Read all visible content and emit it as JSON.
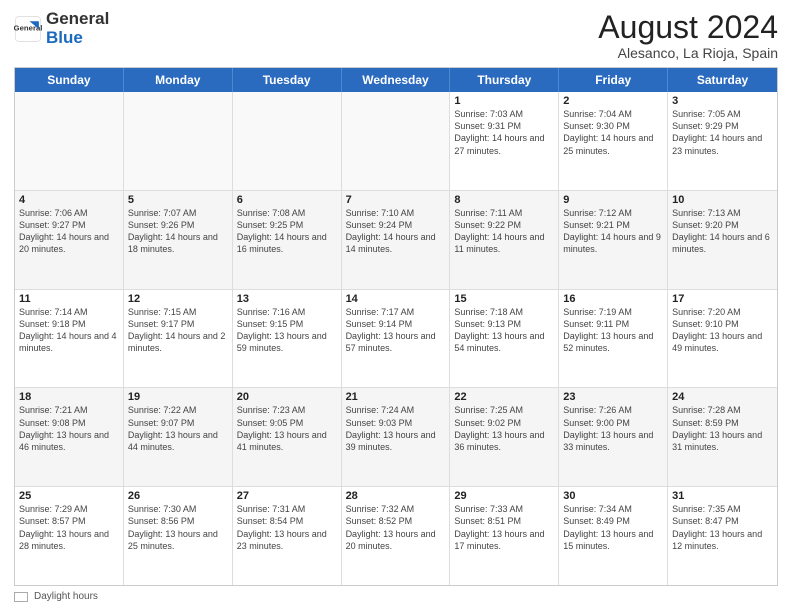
{
  "header": {
    "logo_general": "General",
    "logo_blue": "Blue",
    "main_title": "August 2024",
    "subtitle": "Alesanco, La Rioja, Spain"
  },
  "calendar": {
    "weekdays": [
      "Sunday",
      "Monday",
      "Tuesday",
      "Wednesday",
      "Thursday",
      "Friday",
      "Saturday"
    ],
    "rows": [
      {
        "alt": false,
        "cells": [
          {
            "day": "",
            "info": "",
            "empty": true
          },
          {
            "day": "",
            "info": "",
            "empty": true
          },
          {
            "day": "",
            "info": "",
            "empty": true
          },
          {
            "day": "",
            "info": "",
            "empty": true
          },
          {
            "day": "1",
            "info": "Sunrise: 7:03 AM\nSunset: 9:31 PM\nDaylight: 14 hours and 27 minutes.",
            "empty": false
          },
          {
            "day": "2",
            "info": "Sunrise: 7:04 AM\nSunset: 9:30 PM\nDaylight: 14 hours and 25 minutes.",
            "empty": false
          },
          {
            "day": "3",
            "info": "Sunrise: 7:05 AM\nSunset: 9:29 PM\nDaylight: 14 hours and 23 minutes.",
            "empty": false
          }
        ]
      },
      {
        "alt": true,
        "cells": [
          {
            "day": "4",
            "info": "Sunrise: 7:06 AM\nSunset: 9:27 PM\nDaylight: 14 hours and 20 minutes.",
            "empty": false
          },
          {
            "day": "5",
            "info": "Sunrise: 7:07 AM\nSunset: 9:26 PM\nDaylight: 14 hours and 18 minutes.",
            "empty": false
          },
          {
            "day": "6",
            "info": "Sunrise: 7:08 AM\nSunset: 9:25 PM\nDaylight: 14 hours and 16 minutes.",
            "empty": false
          },
          {
            "day": "7",
            "info": "Sunrise: 7:10 AM\nSunset: 9:24 PM\nDaylight: 14 hours and 14 minutes.",
            "empty": false
          },
          {
            "day": "8",
            "info": "Sunrise: 7:11 AM\nSunset: 9:22 PM\nDaylight: 14 hours and 11 minutes.",
            "empty": false
          },
          {
            "day": "9",
            "info": "Sunrise: 7:12 AM\nSunset: 9:21 PM\nDaylight: 14 hours and 9 minutes.",
            "empty": false
          },
          {
            "day": "10",
            "info": "Sunrise: 7:13 AM\nSunset: 9:20 PM\nDaylight: 14 hours and 6 minutes.",
            "empty": false
          }
        ]
      },
      {
        "alt": false,
        "cells": [
          {
            "day": "11",
            "info": "Sunrise: 7:14 AM\nSunset: 9:18 PM\nDaylight: 14 hours and 4 minutes.",
            "empty": false
          },
          {
            "day": "12",
            "info": "Sunrise: 7:15 AM\nSunset: 9:17 PM\nDaylight: 14 hours and 2 minutes.",
            "empty": false
          },
          {
            "day": "13",
            "info": "Sunrise: 7:16 AM\nSunset: 9:15 PM\nDaylight: 13 hours and 59 minutes.",
            "empty": false
          },
          {
            "day": "14",
            "info": "Sunrise: 7:17 AM\nSunset: 9:14 PM\nDaylight: 13 hours and 57 minutes.",
            "empty": false
          },
          {
            "day": "15",
            "info": "Sunrise: 7:18 AM\nSunset: 9:13 PM\nDaylight: 13 hours and 54 minutes.",
            "empty": false
          },
          {
            "day": "16",
            "info": "Sunrise: 7:19 AM\nSunset: 9:11 PM\nDaylight: 13 hours and 52 minutes.",
            "empty": false
          },
          {
            "day": "17",
            "info": "Sunrise: 7:20 AM\nSunset: 9:10 PM\nDaylight: 13 hours and 49 minutes.",
            "empty": false
          }
        ]
      },
      {
        "alt": true,
        "cells": [
          {
            "day": "18",
            "info": "Sunrise: 7:21 AM\nSunset: 9:08 PM\nDaylight: 13 hours and 46 minutes.",
            "empty": false
          },
          {
            "day": "19",
            "info": "Sunrise: 7:22 AM\nSunset: 9:07 PM\nDaylight: 13 hours and 44 minutes.",
            "empty": false
          },
          {
            "day": "20",
            "info": "Sunrise: 7:23 AM\nSunset: 9:05 PM\nDaylight: 13 hours and 41 minutes.",
            "empty": false
          },
          {
            "day": "21",
            "info": "Sunrise: 7:24 AM\nSunset: 9:03 PM\nDaylight: 13 hours and 39 minutes.",
            "empty": false
          },
          {
            "day": "22",
            "info": "Sunrise: 7:25 AM\nSunset: 9:02 PM\nDaylight: 13 hours and 36 minutes.",
            "empty": false
          },
          {
            "day": "23",
            "info": "Sunrise: 7:26 AM\nSunset: 9:00 PM\nDaylight: 13 hours and 33 minutes.",
            "empty": false
          },
          {
            "day": "24",
            "info": "Sunrise: 7:28 AM\nSunset: 8:59 PM\nDaylight: 13 hours and 31 minutes.",
            "empty": false
          }
        ]
      },
      {
        "alt": false,
        "cells": [
          {
            "day": "25",
            "info": "Sunrise: 7:29 AM\nSunset: 8:57 PM\nDaylight: 13 hours and 28 minutes.",
            "empty": false
          },
          {
            "day": "26",
            "info": "Sunrise: 7:30 AM\nSunset: 8:56 PM\nDaylight: 13 hours and 25 minutes.",
            "empty": false
          },
          {
            "day": "27",
            "info": "Sunrise: 7:31 AM\nSunset: 8:54 PM\nDaylight: 13 hours and 23 minutes.",
            "empty": false
          },
          {
            "day": "28",
            "info": "Sunrise: 7:32 AM\nSunset: 8:52 PM\nDaylight: 13 hours and 20 minutes.",
            "empty": false
          },
          {
            "day": "29",
            "info": "Sunrise: 7:33 AM\nSunset: 8:51 PM\nDaylight: 13 hours and 17 minutes.",
            "empty": false
          },
          {
            "day": "30",
            "info": "Sunrise: 7:34 AM\nSunset: 8:49 PM\nDaylight: 13 hours and 15 minutes.",
            "empty": false
          },
          {
            "day": "31",
            "info": "Sunrise: 7:35 AM\nSunset: 8:47 PM\nDaylight: 13 hours and 12 minutes.",
            "empty": false
          }
        ]
      }
    ]
  },
  "footer": {
    "daylight_label": "Daylight hours"
  }
}
